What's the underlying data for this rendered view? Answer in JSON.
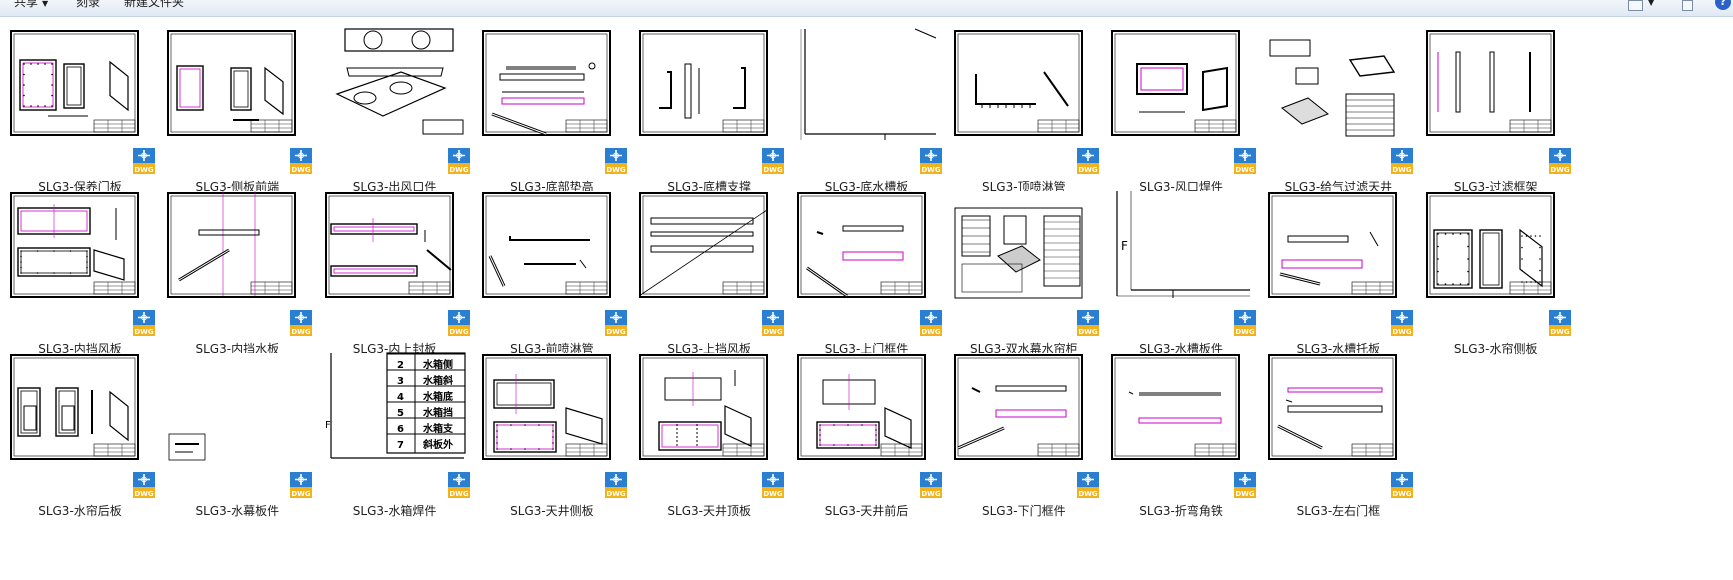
{
  "toolbar": {
    "share_label": "共享",
    "burn_label": "刻录",
    "new_folder_label": "新建文件夹",
    "help_glyph": "?"
  },
  "badge_text": "DWG",
  "colors": {
    "badge_blue": "#2a7fd0",
    "badge_yellow": "#f2b21e",
    "line_magenta": "#cc00cc"
  },
  "files": [
    {
      "name": "SLG3-保养门板",
      "drawing": "door-panel"
    },
    {
      "name": "SLG3-侧板前端",
      "drawing": "side-panel-front"
    },
    {
      "name": "SLG3-出风口件",
      "drawing": "outlet"
    },
    {
      "name": "SLG3-底部垫高",
      "drawing": "bottom-pad"
    },
    {
      "name": "SLG3-底槽支撑",
      "drawing": "bottom-support"
    },
    {
      "name": "SLG3-底水槽板",
      "drawing": "corner-zoom"
    },
    {
      "name": "SLG3-顶喷淋管",
      "drawing": "spray-pipe"
    },
    {
      "name": "SLG3-风口焊件",
      "drawing": "outlet-weld"
    },
    {
      "name": "SLG3-给气过滤天井",
      "drawing": "filter-ceiling"
    },
    {
      "name": "SLG3-过滤框架",
      "drawing": "filter-frame"
    },
    {
      "name": "SLG3-内挡风板",
      "drawing": "inner-baffle"
    },
    {
      "name": "SLG3-内挡水板",
      "drawing": "inner-water-baffle"
    },
    {
      "name": "SLG3-内上封板",
      "drawing": "inner-top-seal"
    },
    {
      "name": "SLG3-前喷淋管",
      "drawing": "front-spray"
    },
    {
      "name": "SLG3-上挡风板",
      "drawing": "top-baffle"
    },
    {
      "name": "SLG3-上门框件",
      "drawing": "top-door-frame"
    },
    {
      "name": "SLG3-双水幕水帘柜",
      "drawing": "assembly"
    },
    {
      "name": "SLG3-水槽板件",
      "drawing": "corner-zoom-f"
    },
    {
      "name": "SLG3-水槽托板",
      "drawing": "tank-tray"
    },
    {
      "name": "SLG3-水帘侧板",
      "drawing": "curtain-side"
    },
    {
      "name": "SLG3-水帘后板",
      "drawing": "curtain-back"
    },
    {
      "name": "SLG3-水幕板件",
      "drawing": "small-detail"
    },
    {
      "name": "SLG3-水箱焊件",
      "drawing": "bom-table"
    },
    {
      "name": "SLG3-天井侧板",
      "drawing": "ceiling-side"
    },
    {
      "name": "SLG3-天井顶板",
      "drawing": "ceiling-top"
    },
    {
      "name": "SLG3-天井前后",
      "drawing": "ceiling-front-back"
    },
    {
      "name": "SLG3-下门框件",
      "drawing": "bottom-door-frame"
    },
    {
      "name": "SLG3-折弯角铁",
      "drawing": "bent-angle"
    },
    {
      "name": "SLG3-左右门框",
      "drawing": "lr-door-frame"
    }
  ],
  "bom_rows": [
    {
      "no": "2",
      "text": "水箱侧"
    },
    {
      "no": "3",
      "text": "水箱斜"
    },
    {
      "no": "4",
      "text": "水箱底"
    },
    {
      "no": "5",
      "text": "水箱挡"
    },
    {
      "no": "6",
      "text": "水箱支"
    },
    {
      "no": "7",
      "text": "斜板外"
    }
  ],
  "corner_letter": "F"
}
